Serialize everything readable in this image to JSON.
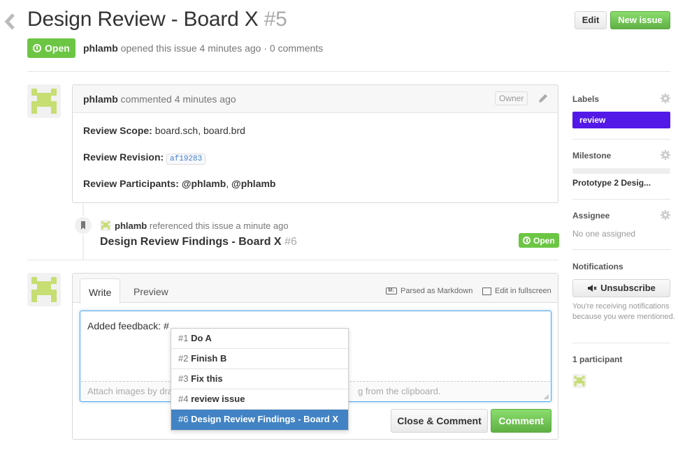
{
  "issue": {
    "title": "Design Review - Board X",
    "number": "#5",
    "state": "Open",
    "author": "phlamb",
    "opened_text": "opened this issue 4 minutes ago",
    "comments_count_text": "· 0 comments"
  },
  "header": {
    "edit_label": "Edit",
    "new_issue_label": "New issue"
  },
  "comment": {
    "author": "phlamb",
    "time_text": "commented 4 minutes ago",
    "owner_badge": "Owner",
    "scope_label": "Review Scope:",
    "scope_value": "board.sch, board.brd",
    "revision_label": "Review Revision:",
    "revision_value": "af19283",
    "participants_label": "Review Participants:",
    "participant_1": "@phlamb",
    "participant_sep": ",",
    "participant_2": "@phlamb"
  },
  "reference": {
    "author": "phlamb",
    "text": "referenced this issue a minute ago",
    "title": "Design Review Findings - Board X",
    "number": "#6",
    "state": "Open"
  },
  "composer": {
    "tab_write": "Write",
    "tab_preview": "Preview",
    "markdown_hint": "Parsed as Markdown",
    "fullscreen_label": "Edit in fullscreen",
    "value": "Added feedback: #",
    "drop_hint_left": "Attach images by dra",
    "drop_hint_right": "g from the clipboard.",
    "close_comment_label": "Close & Comment",
    "comment_label": "Comment"
  },
  "autocomplete": {
    "items": [
      {
        "num": "#1",
        "title": "Do A",
        "selected": false
      },
      {
        "num": "#2",
        "title": "Finish B",
        "selected": false
      },
      {
        "num": "#3",
        "title": "Fix this",
        "selected": false
      },
      {
        "num": "#4",
        "title": "review issue",
        "selected": false
      },
      {
        "num": "#6",
        "title": "Design Review Findings - Board X",
        "selected": true
      }
    ]
  },
  "sidebar": {
    "labels_heading": "Labels",
    "label_review": "review",
    "label_review_color": "#5319e7",
    "milestone_heading": "Milestone",
    "milestone_name": "Prototype 2 Desig...",
    "assignee_heading": "Assignee",
    "assignee_value": "No one assigned",
    "notifications_heading": "Notifications",
    "unsubscribe_label": "Unsubscribe",
    "notifications_text": "You're receiving notifications because you were mentioned.",
    "participants_heading": "1 participant"
  },
  "colors": {
    "open_green": "#6cc644",
    "link_blue": "#4183c4",
    "avatar_green": "#c6de72"
  }
}
